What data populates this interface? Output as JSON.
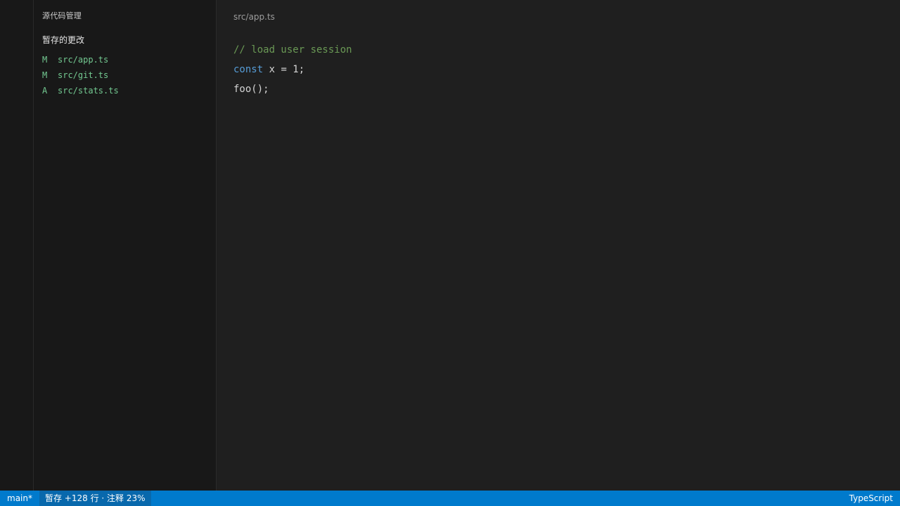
{
  "sidebar": {
    "title": "源代码管理",
    "section_title": "暂存的更改",
    "changes": [
      {
        "status": "M",
        "path": "src/app.ts"
      },
      {
        "status": "M",
        "path": "src/git.ts"
      },
      {
        "status": "A",
        "path": "src/stats.ts"
      }
    ]
  },
  "editor": {
    "breadcrumb": "src/app.ts",
    "lines": [
      {
        "comment": "// load user session"
      },
      {
        "keyword": "const",
        "rest": " x = 1;"
      },
      {
        "text": "foo();"
      }
    ]
  },
  "status_bar": {
    "branch": "main*",
    "stats": "暂存 +128 行 · 注释 23%",
    "language": "TypeScript"
  },
  "colors": {
    "status_bar": "#007acc",
    "git_added_modified": "#73c991",
    "comment": "#6a9955",
    "keyword": "#569cd6"
  }
}
